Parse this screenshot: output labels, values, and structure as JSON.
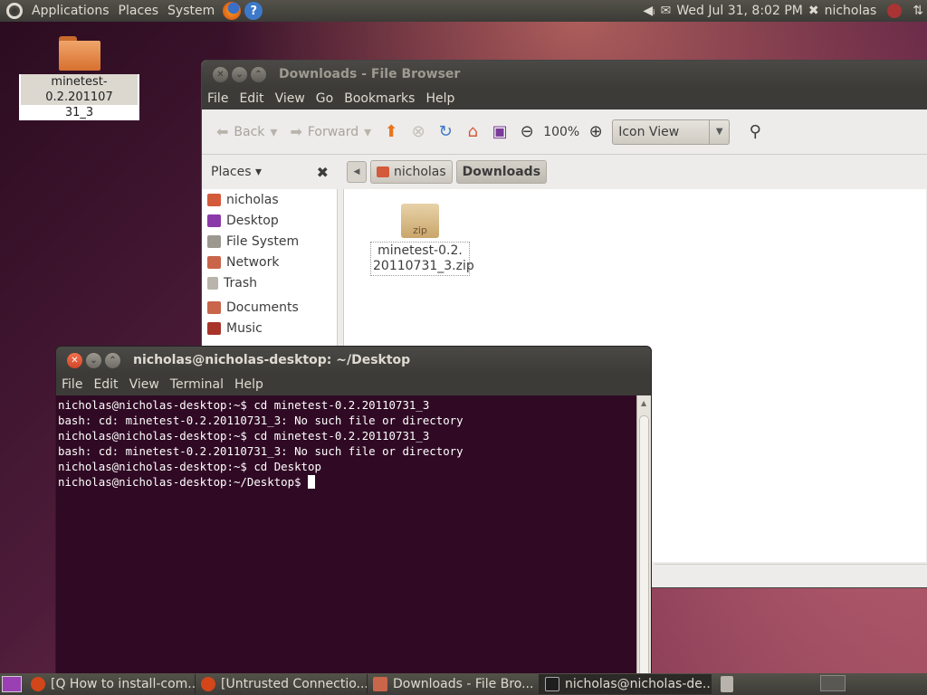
{
  "top_panel": {
    "menus": [
      "Applications",
      "Places",
      "System"
    ],
    "clock": "Wed Jul 31,  8:02 PM",
    "user": "nicholas"
  },
  "desktop": {
    "icon_label_line1": "minetest-0.2.201107",
    "icon_label_line2": "31_3"
  },
  "file_browser": {
    "title": "Downloads - File Browser",
    "menu": [
      "File",
      "Edit",
      "View",
      "Go",
      "Bookmarks",
      "Help"
    ],
    "toolbar": {
      "back": "Back",
      "forward": "Forward",
      "zoom": "100%",
      "view_mode": "Icon View"
    },
    "places_label": "Places",
    "breadcrumbs": [
      "nicholas",
      "Downloads"
    ],
    "sidebar": [
      "nicholas",
      "Desktop",
      "File System",
      "Network",
      "Trash",
      "Documents",
      "Music"
    ],
    "file": {
      "line1": "minetest-0.2.",
      "line2": "20110731_3.zip",
      "badge": "zip"
    }
  },
  "terminal": {
    "title": "nicholas@nicholas-desktop: ~/Desktop",
    "menu": [
      "File",
      "Edit",
      "View",
      "Terminal",
      "Help"
    ],
    "lines": [
      "nicholas@nicholas-desktop:~$ cd minetest-0.2.20110731_3",
      "bash: cd: minetest-0.2.20110731_3: No such file or directory",
      "nicholas@nicholas-desktop:~$ cd minetest-0.2.20110731_3",
      "bash: cd: minetest-0.2.20110731_3: No such file or directory",
      "nicholas@nicholas-desktop:~$ cd Desktop",
      "nicholas@nicholas-desktop:~/Desktop$ "
    ]
  },
  "taskbar": [
    "[Q How to install-com...",
    "[Untrusted Connectio...",
    "Downloads - File Bro...",
    "nicholas@nicholas-de..."
  ]
}
